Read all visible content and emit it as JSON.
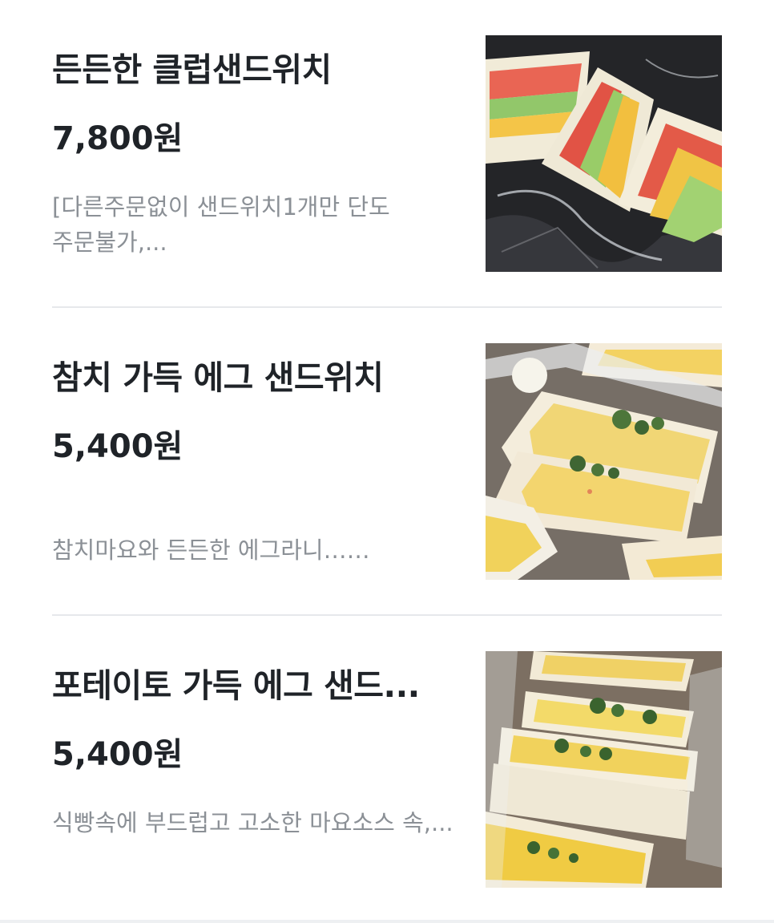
{
  "menu": {
    "items": [
      {
        "name": "든든한 클럽샌드위치",
        "price": "7,800원",
        "description": "[다른주문없이 샌드위치1개만 단도 주문불가,...",
        "photo_icon": "club-sandwich-photo"
      },
      {
        "name": "참치 가득 에그 샌드위치",
        "price": "5,400원",
        "description": "참치마요와 든든한 에그라니……",
        "photo_icon": "tuna-egg-sandwich-photo"
      },
      {
        "name": "포테이토 가득 에그 샌드...",
        "price": "5,400원",
        "description": "식빵속에 부드럽고 고소한 마요소스 속,...",
        "photo_icon": "potato-egg-sandwich-photo"
      }
    ]
  },
  "colors": {
    "title": "#1f2328",
    "description": "#8b9096",
    "divider": "#e6e8eb",
    "background": "#ffffff"
  }
}
